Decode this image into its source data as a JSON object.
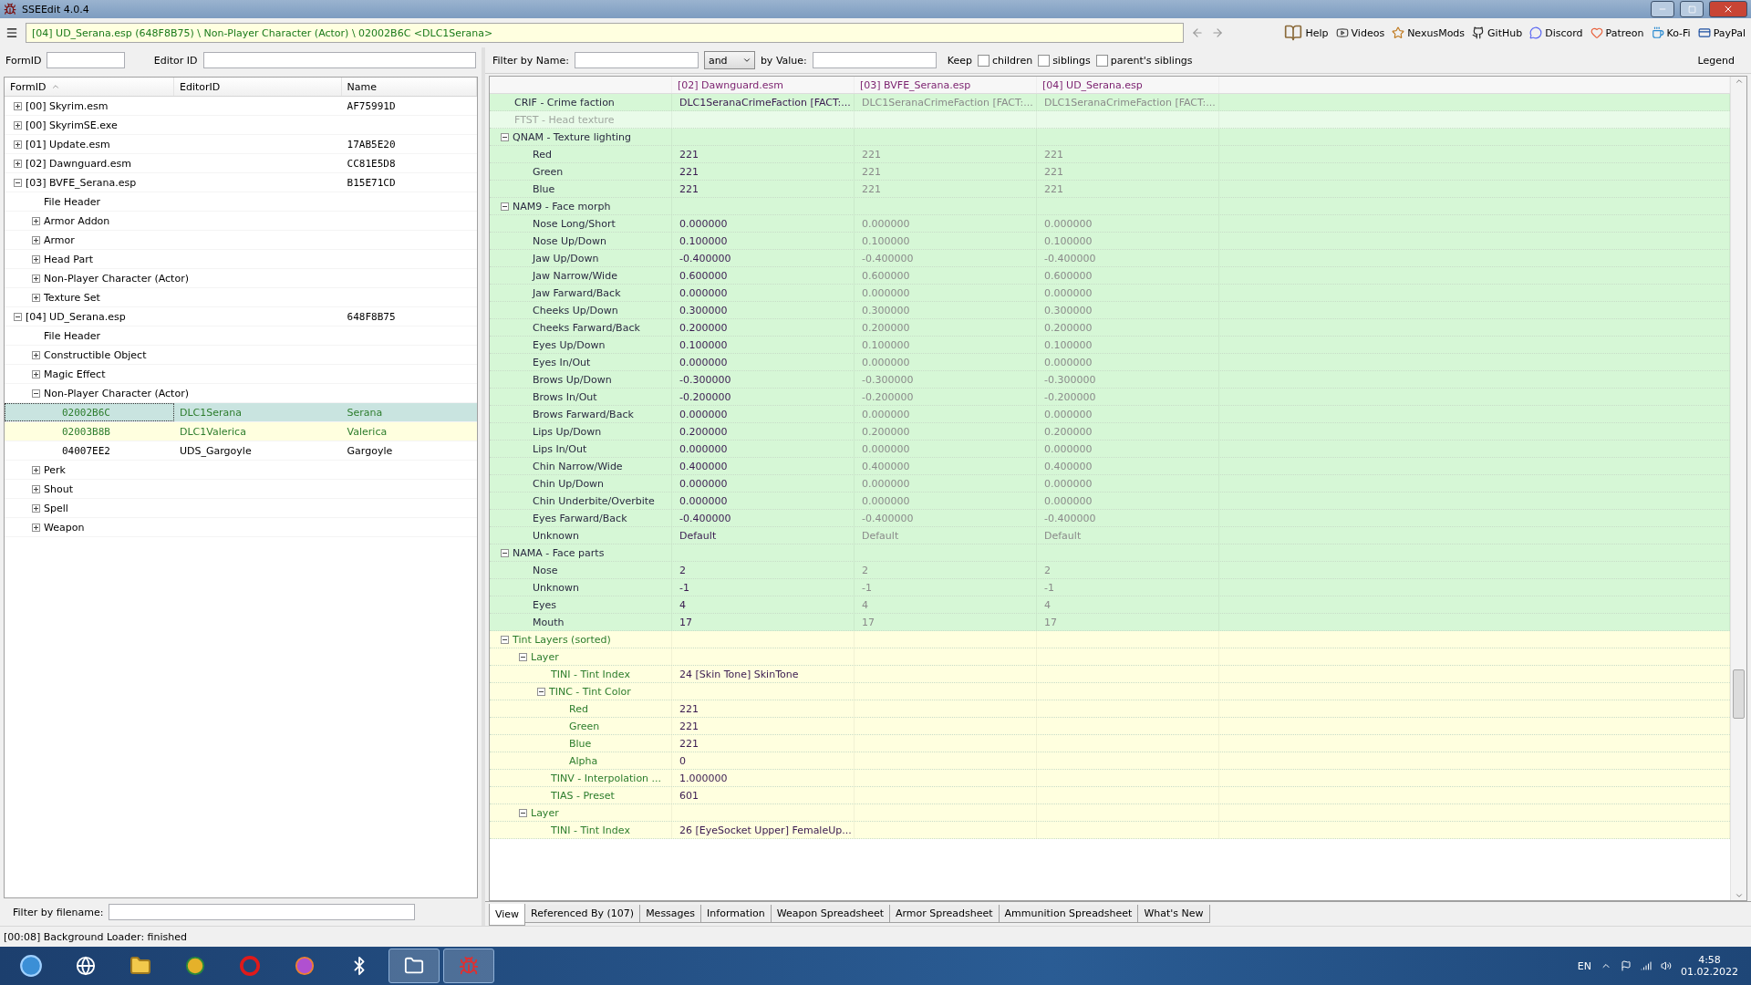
{
  "window": {
    "title": "SSEEdit 4.0.4"
  },
  "toolbar": {
    "path": "[04] UD_Serana.esp (648F8B75) \\ Non-Player Character (Actor) \\ 02002B6C <DLC1Serana>",
    "links": [
      {
        "kind": "help",
        "label": "Help"
      },
      {
        "kind": "videos",
        "label": "Videos"
      },
      {
        "kind": "nexus",
        "label": "NexusMods"
      },
      {
        "kind": "github",
        "label": "GitHub"
      },
      {
        "kind": "discord",
        "label": "Discord"
      },
      {
        "kind": "patreon",
        "label": "Patreon"
      },
      {
        "kind": "kofi",
        "label": "Ko-Fi"
      },
      {
        "kind": "paypal",
        "label": "PayPal"
      }
    ]
  },
  "navigator": {
    "formid_label": "FormID",
    "editorid_label": "Editor ID",
    "columns": [
      "FormID",
      "EditorID",
      "Name"
    ],
    "tree": [
      {
        "label": "[00] Skyrim.esm",
        "name": "AF75991D",
        "expanded": false
      },
      {
        "label": "[00] SkyrimSE.exe",
        "expanded": false
      },
      {
        "label": "[01] Update.esm",
        "name": "17AB5E20",
        "expanded": false
      },
      {
        "label": "[02] Dawnguard.esm",
        "name": "CC81E5D8",
        "expanded": false
      },
      {
        "label": "[03] BVFE_Serana.esp",
        "name": "B15E71CD",
        "expanded": true,
        "children": [
          {
            "label": "File Header"
          },
          {
            "label": "Armor Addon",
            "expanded": false
          },
          {
            "label": "Armor",
            "expanded": false
          },
          {
            "label": "Head Part",
            "expanded": false
          },
          {
            "label": "Non-Player Character (Actor)",
            "expanded": false
          },
          {
            "label": "Texture Set",
            "expanded": false
          }
        ]
      },
      {
        "label": "[04] UD_Serana.esp",
        "name": "648F8B75",
        "expanded": true,
        "children": [
          {
            "label": "File Header"
          },
          {
            "label": "Constructible Object",
            "expanded": false
          },
          {
            "label": "Magic Effect",
            "expanded": false
          },
          {
            "label": "Non-Player Character (Actor)",
            "expanded": true,
            "children": [
              {
                "kind": "record",
                "formid": "02002B6C",
                "editor_id": "DLC1Serana",
                "name": "Serana",
                "selected": true,
                "highlighted": false,
                "overridden": true
              },
              {
                "kind": "record",
                "formid": "02003B8B",
                "editor_id": "DLC1Valerica",
                "name": "Valerica",
                "selected": false,
                "highlighted": true,
                "overridden": true
              },
              {
                "kind": "record",
                "formid": "04007EE2",
                "editor_id": "UDS_Gargoyle",
                "name": "Gargoyle",
                "selected": false,
                "highlighted": false,
                "overridden": false
              }
            ]
          },
          {
            "label": "Perk",
            "expanded": false
          },
          {
            "label": "Shout",
            "expanded": false
          },
          {
            "label": "Spell",
            "expanded": false
          },
          {
            "label": "Weapon",
            "expanded": false
          }
        ]
      }
    ],
    "filename_filter_label": "Filter by filename:"
  },
  "filter_bar": {
    "name_label": "Filter by Name:",
    "operator": "and",
    "value_label": "by Value:",
    "keep_label": "Keep",
    "keep_options": [
      {
        "label": "children",
        "checked": false
      },
      {
        "label": "siblings",
        "checked": false
      },
      {
        "label": "parent's siblings",
        "checked": false
      }
    ],
    "legend": "Legend"
  },
  "record_view": {
    "columns": [
      "[02] Dawnguard.esm",
      "[03] BVFE_Serana.esp",
      "[04] UD_Serana.esp"
    ],
    "rows": [
      {
        "kind": "identical",
        "label": "CRIF - Crime faction",
        "values": [
          "DLC1SeranaCrimeFaction [FACT:...",
          "DLC1SeranaCrimeFaction [FACT:...",
          "DLC1SeranaCrimeFaction [FACT:..."
        ]
      },
      {
        "kind": "empty",
        "label": "FTST - Head texture"
      },
      {
        "kind": "identical",
        "label": "QNAM - Texture lighting",
        "expanded": true,
        "children": [
          {
            "label": "Red",
            "values": [
              "221",
              "221",
              "221"
            ]
          },
          {
            "label": "Green",
            "values": [
              "221",
              "221",
              "221"
            ]
          },
          {
            "label": "Blue",
            "values": [
              "221",
              "221",
              "221"
            ]
          }
        ]
      },
      {
        "kind": "identical",
        "label": "NAM9 - Face morph",
        "expanded": true,
        "children": [
          {
            "label": "Nose Long/Short",
            "values": [
              "0.000000",
              "0.000000",
              "0.000000"
            ]
          },
          {
            "label": "Nose Up/Down",
            "values": [
              "0.100000",
              "0.100000",
              "0.100000"
            ]
          },
          {
            "label": "Jaw Up/Down",
            "values": [
              "-0.400000",
              "-0.400000",
              "-0.400000"
            ]
          },
          {
            "label": "Jaw Narrow/Wide",
            "values": [
              "0.600000",
              "0.600000",
              "0.600000"
            ]
          },
          {
            "label": "Jaw Farward/Back",
            "values": [
              "0.000000",
              "0.000000",
              "0.000000"
            ]
          },
          {
            "label": "Cheeks Up/Down",
            "values": [
              "0.300000",
              "0.300000",
              "0.300000"
            ]
          },
          {
            "label": "Cheeks Farward/Back",
            "values": [
              "0.200000",
              "0.200000",
              "0.200000"
            ]
          },
          {
            "label": "Eyes Up/Down",
            "values": [
              "0.100000",
              "0.100000",
              "0.100000"
            ]
          },
          {
            "label": "Eyes In/Out",
            "values": [
              "0.000000",
              "0.000000",
              "0.000000"
            ]
          },
          {
            "label": "Brows Up/Down",
            "values": [
              "-0.300000",
              "-0.300000",
              "-0.300000"
            ]
          },
          {
            "label": "Brows In/Out",
            "values": [
              "-0.200000",
              "-0.200000",
              "-0.200000"
            ]
          },
          {
            "label": "Brows Farward/Back",
            "values": [
              "0.000000",
              "0.000000",
              "0.000000"
            ]
          },
          {
            "label": "Lips Up/Down",
            "values": [
              "0.200000",
              "0.200000",
              "0.200000"
            ]
          },
          {
            "label": "Lips In/Out",
            "values": [
              "0.000000",
              "0.000000",
              "0.000000"
            ]
          },
          {
            "label": "Chin Narrow/Wide",
            "values": [
              "0.400000",
              "0.400000",
              "0.400000"
            ]
          },
          {
            "label": "Chin Up/Down",
            "values": [
              "0.000000",
              "0.000000",
              "0.000000"
            ]
          },
          {
            "label": "Chin Underbite/Overbite",
            "values": [
              "0.000000",
              "0.000000",
              "0.000000"
            ]
          },
          {
            "label": "Eyes Farward/Back",
            "values": [
              "-0.400000",
              "-0.400000",
              "-0.400000"
            ]
          },
          {
            "label": "Unknown",
            "values": [
              "Default",
              "Default",
              "Default"
            ]
          }
        ]
      },
      {
        "kind": "identical",
        "label": "NAMA - Face parts",
        "expanded": true,
        "children": [
          {
            "label": "Nose",
            "values": [
              "2",
              "2",
              "2"
            ]
          },
          {
            "label": "Unknown",
            "values": [
              "-1",
              "-1",
              "-1"
            ]
          },
          {
            "label": "Eyes",
            "values": [
              "4",
              "4",
              "4"
            ]
          },
          {
            "label": "Mouth",
            "values": [
              "17",
              "17",
              "17"
            ]
          }
        ]
      },
      {
        "kind": "added",
        "label": "Tint Layers (sorted)",
        "expanded": true,
        "children": [
          {
            "label": "Layer",
            "expanded": true,
            "children": [
              {
                "label": "TINI - Tint Index",
                "values": [
                  "24 [Skin Tone] SkinTone"
                ]
              },
              {
                "label": "TINC - Tint Color",
                "expanded": true,
                "children": [
                  {
                    "label": "Red",
                    "values": [
                      "221"
                    ]
                  },
                  {
                    "label": "Green",
                    "values": [
                      "221"
                    ]
                  },
                  {
                    "label": "Blue",
                    "values": [
                      "221"
                    ]
                  },
                  {
                    "label": "Alpha",
                    "values": [
                      "0"
                    ]
                  }
                ]
              },
              {
                "label": "TINV - Interpolation ...",
                "values": [
                  "1.000000"
                ]
              },
              {
                "label": "TIAS - Preset",
                "values": [
                  "601"
                ]
              }
            ]
          },
          {
            "label": "Layer",
            "expanded": true,
            "children": [
              {
                "label": "TINI - Tint Index",
                "values": [
                  "26 [EyeSocket Upper] FemaleUp..."
                ]
              }
            ]
          }
        ]
      }
    ]
  },
  "tabs": [
    {
      "label": "View",
      "selected": true
    },
    {
      "label": "Referenced By (107)",
      "selected": false
    },
    {
      "label": "Messages",
      "selected": false
    },
    {
      "label": "Information",
      "selected": false
    },
    {
      "label": "Weapon Spreadsheet",
      "selected": false
    },
    {
      "label": "Armor Spreadsheet",
      "selected": false
    },
    {
      "label": "Ammunition Spreadsheet",
      "selected": false
    },
    {
      "label": "What's New",
      "selected": false
    }
  ],
  "status_bar": "[00:08] Background Loader: finished",
  "taskbar": {
    "language": "EN",
    "time": "4:58",
    "date": "01.02.2022"
  }
}
